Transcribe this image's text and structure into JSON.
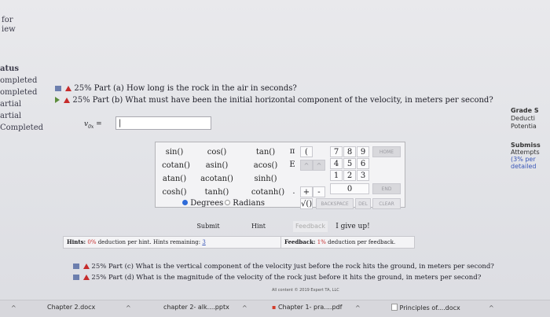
{
  "sidebar_top": {
    "line1": "for",
    "line2": "iew"
  },
  "sidebar_status": {
    "header": "atus",
    "items": [
      "ompleted",
      "ompleted",
      "artial",
      "artial",
      "Completed"
    ]
  },
  "parts": {
    "a": {
      "pct": "25%",
      "label": "Part (a)",
      "question": "How long is the rock in the air in seconds?"
    },
    "b": {
      "pct": "25%",
      "label": "Part (b)",
      "question": "What must have been the initial horizontal component of the velocity, in meters per second?"
    },
    "c": {
      "pct": "25%",
      "label": "Part (c)",
      "question": "What is the vertical component of the velocity just before the rock hits the ground, in meters per second?"
    },
    "d": {
      "pct": "25%",
      "label": "Part (d)",
      "question": "What is the magnitude of the velocity of the rock just before it hits the ground, in meters per second?"
    }
  },
  "input": {
    "label": "v",
    "sub": "0x",
    "eq": "=",
    "value": "|"
  },
  "calculator": {
    "functions": [
      [
        "sin()",
        "cos()",
        "tan()"
      ],
      [
        "cotan()",
        "asin()",
        "acos()"
      ],
      [
        "atan()",
        "acotan()",
        "sinh()"
      ],
      [
        "cosh()",
        "tanh()",
        "cotanh()"
      ]
    ],
    "mode_degrees": "Degrees",
    "mode_radians": "Radians",
    "symbols": {
      "pi": "π",
      "paren": "(",
      "e": "E",
      "up": "^",
      "caret": "^",
      "plus": "+",
      "dash": "-",
      "dot": ".",
      "sqrt": "√()"
    },
    "keys": [
      "7",
      "8",
      "9",
      "4",
      "5",
      "6",
      "1",
      "2",
      "3",
      "0"
    ],
    "home": "HOME",
    "end": "END",
    "backspace": "BACKSPACE",
    "del": "DEL",
    "clear": "CLEAR"
  },
  "actions": {
    "submit": "Submit",
    "hint": "Hint",
    "feedback": "Feedback",
    "giveup": "I give up!"
  },
  "hints": {
    "label": "Hints:",
    "pct": "0%",
    "text": "deduction per hint. Hints remaining:",
    "remaining": "3"
  },
  "feedback": {
    "label": "Feedback:",
    "pct": "1%",
    "text": "deduction per feedback."
  },
  "right_panel": {
    "grade": "Grade S",
    "deduction": "Deducti",
    "potential": "Potentia",
    "submiss": "Submiss",
    "attempts": "Attempts",
    "per": "(3% per",
    "detailed": "detailed"
  },
  "copyright": "All content © 2019 Expert TA, LLC",
  "taskbar": {
    "items": [
      "Chapter 2.docx",
      "chapter 2- alk....pptx",
      "Chapter 1- pra....pdf",
      "Principles of....docx"
    ]
  },
  "colors": {
    "warn": "#c62b2b",
    "list": "#6d7fae",
    "play": "#5c8c3c",
    "link": "#3a57b8"
  }
}
